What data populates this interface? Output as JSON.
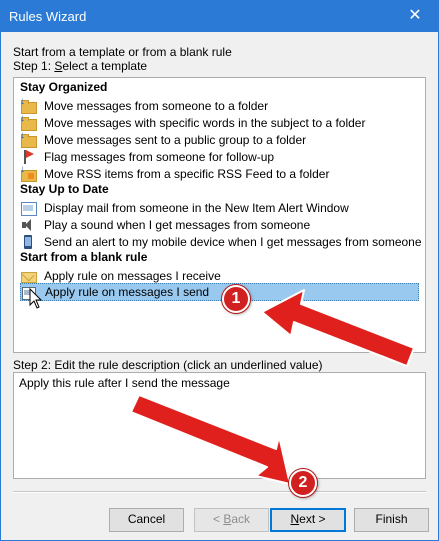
{
  "window": {
    "title": "Rules Wizard",
    "close_glyph": "✕"
  },
  "intro": "Start from a template or from a blank rule",
  "step1": {
    "prefix": "Step 1: ",
    "underlined": "S",
    "rest": "elect a template"
  },
  "groups": [
    {
      "label": "Stay Organized"
    },
    {
      "label": "Stay Up to Date"
    },
    {
      "label": "Start from a blank rule"
    }
  ],
  "items": [
    {
      "label": "Move messages from someone to a folder",
      "icon": "move-folder-icon"
    },
    {
      "label": "Move messages with specific words in the subject to a folder",
      "icon": "move-folder-icon"
    },
    {
      "label": "Move messages sent to a public group to a folder",
      "icon": "move-folder-icon"
    },
    {
      "label": "Flag messages from someone for follow-up",
      "icon": "flag-icon"
    },
    {
      "label": "Move RSS items from a specific RSS Feed to a folder",
      "icon": "rss-folder-icon"
    },
    {
      "label": "Display mail from someone in the New Item Alert Window",
      "icon": "mail-window-icon"
    },
    {
      "label": "Play a sound when I get messages from someone",
      "icon": "speaker-icon"
    },
    {
      "label": "Send an alert to my mobile device when I get messages from someone",
      "icon": "mobile-phone-icon"
    },
    {
      "label": "Apply rule on messages I receive",
      "icon": "envelope-icon"
    },
    {
      "label": "Apply rule on messages I send",
      "icon": "send-message-icon",
      "selected": true
    }
  ],
  "step2": {
    "label": "Step 2: Edit the rule description (click an underlined value)",
    "description": "Apply this rule after I send the message"
  },
  "buttons": {
    "cancel": "Cancel",
    "back": {
      "pre": "< ",
      "ul": "B",
      "post": "ack"
    },
    "next": {
      "ul": "N",
      "post": "ext >"
    },
    "finish": "Finish"
  },
  "annotations": {
    "badge1": "1",
    "badge2": "2",
    "accent": "#d0201f"
  }
}
